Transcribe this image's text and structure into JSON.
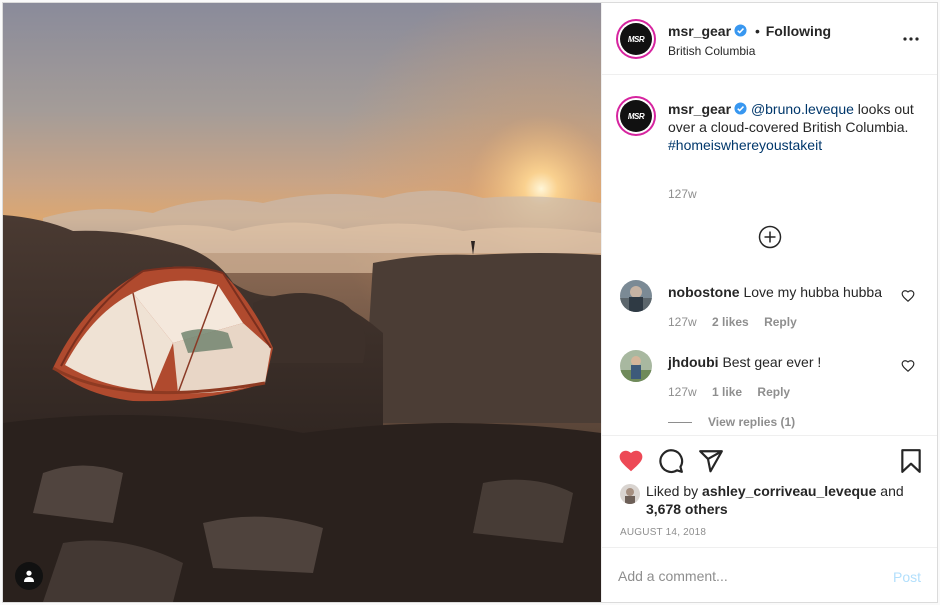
{
  "header": {
    "username": "msr_gear",
    "separator": "•",
    "follow_state": "Following",
    "location": "British Columbia",
    "logo_text": "MSR"
  },
  "caption": {
    "username": "msr_gear",
    "mention": "@bruno.leveque",
    "text": "looks out over a cloud-covered British Columbia.",
    "hashtag": "#homeiswhereyoustakeit",
    "time": "127w"
  },
  "comments": [
    {
      "username": "nobostone",
      "text": "Love my hubba hubba",
      "time": "127w",
      "likes": "2 likes",
      "reply": "Reply"
    },
    {
      "username": "jhdoubi",
      "text": "Best gear ever !",
      "time": "127w",
      "likes": "1 like",
      "reply": "Reply"
    }
  ],
  "view_replies": "View replies (1)",
  "likes": {
    "prefix": "Liked by",
    "user": "ashley_corriveau_leveque",
    "and": "and",
    "others": "3,678 others"
  },
  "date": "AUGUST 14, 2018",
  "add_comment": {
    "placeholder": "Add a comment...",
    "post_label": "Post"
  },
  "icons": {
    "like": "heart-filled-icon",
    "comment": "comment-bubble-icon",
    "share": "paper-plane-icon",
    "save": "bookmark-icon",
    "more": "ellipsis-icon",
    "load_more": "plus-circle-icon",
    "tagged_users": "person-icon",
    "verified": "verified-badge-icon"
  },
  "colors": {
    "like": "#ed4956",
    "link": "#00376b",
    "muted": "#8e8e8e",
    "verified": "#3897f0",
    "post_disabled": "#b2dffc"
  }
}
